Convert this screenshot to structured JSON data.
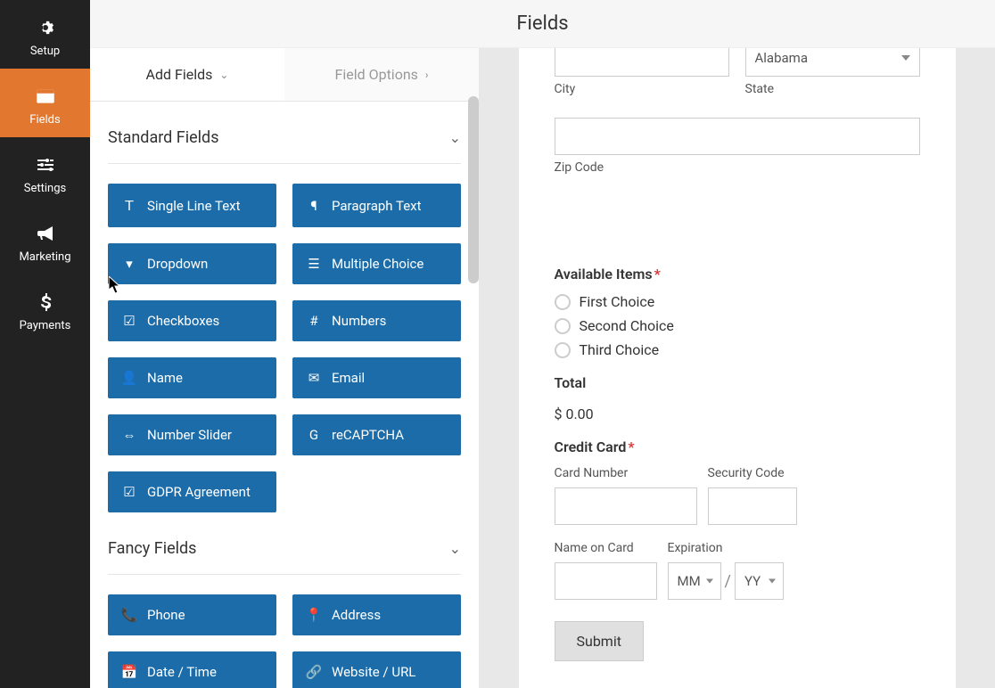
{
  "topbar": {
    "title": "Fields"
  },
  "sidebar": {
    "items": [
      {
        "label": "Setup"
      },
      {
        "label": "Fields"
      },
      {
        "label": "Settings"
      },
      {
        "label": "Marketing"
      },
      {
        "label": "Payments"
      }
    ]
  },
  "tabs": {
    "add_fields": "Add Fields",
    "field_options": "Field Options"
  },
  "sections": {
    "standard": {
      "title": "Standard Fields",
      "fields": {
        "single_line": "Single Line Text",
        "paragraph": "Paragraph Text",
        "dropdown": "Dropdown",
        "multiple_choice": "Multiple Choice",
        "checkboxes": "Checkboxes",
        "numbers": "Numbers",
        "name": "Name",
        "email": "Email",
        "number_slider": "Number Slider",
        "recaptcha": "reCAPTCHA",
        "gdpr": "GDPR Agreement"
      }
    },
    "fancy": {
      "title": "Fancy Fields",
      "fields": {
        "phone": "Phone",
        "address": "Address",
        "datetime": "Date / Time",
        "website": "Website / URL"
      }
    }
  },
  "preview": {
    "address": {
      "state_value": "Alabama",
      "city_label": "City",
      "state_label": "State",
      "zip_label": "Zip Code"
    },
    "items": {
      "label": "Available Items",
      "choices": [
        "First Choice",
        "Second Choice",
        "Third Choice"
      ]
    },
    "total": {
      "label": "Total",
      "value": "$ 0.00"
    },
    "credit_card": {
      "label": "Credit Card",
      "card_number": "Card Number",
      "security_code": "Security Code",
      "name_on_card": "Name on Card",
      "expiration": "Expiration",
      "mm": "MM",
      "yy": "YY"
    },
    "submit": "Submit"
  }
}
